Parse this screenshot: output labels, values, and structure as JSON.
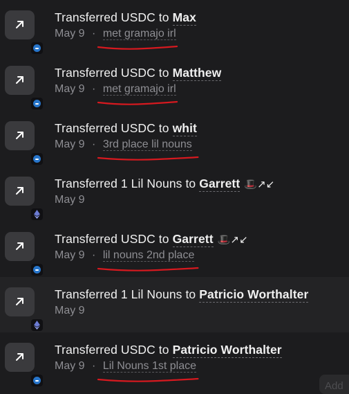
{
  "transactions": [
    {
      "action": "Transferred USDC to",
      "recipient": "Max",
      "recipient_extra": "",
      "date": "May 9",
      "note": "met gramajo irl",
      "asset_icon": "usdc-icon",
      "annotated": true,
      "highlight": false
    },
    {
      "action": "Transferred USDC to",
      "recipient": "Matthew",
      "recipient_extra": "",
      "date": "May 9",
      "note": "met gramajo irl",
      "asset_icon": "usdc-icon",
      "annotated": true,
      "highlight": false
    },
    {
      "action": "Transferred USDC to",
      "recipient": "whit",
      "recipient_extra": "",
      "date": "May 9",
      "note": "3rd place lil nouns",
      "asset_icon": "usdc-icon",
      "annotated": true,
      "highlight": false
    },
    {
      "action": "Transferred 1 Lil Nouns to",
      "recipient": "Garrett",
      "recipient_extra": "🎩↗↙",
      "date": "May 9",
      "note": "",
      "asset_icon": "ethereum-icon",
      "annotated": false,
      "highlight": false
    },
    {
      "action": "Transferred USDC to",
      "recipient": "Garrett",
      "recipient_extra": "🎩↗↙",
      "date": "May 9",
      "note": "lil nouns 2nd place",
      "asset_icon": "usdc-icon",
      "annotated": true,
      "highlight": false
    },
    {
      "action": "Transferred 1 Lil Nouns to",
      "recipient": "Patricio Worthalter",
      "recipient_extra": "",
      "date": "May 9",
      "note": "",
      "asset_icon": "ethereum-icon",
      "annotated": false,
      "highlight": true
    },
    {
      "action": "Transferred USDC to",
      "recipient": "Patricio Worthalter",
      "recipient_extra": "",
      "date": "May 9",
      "note": "Lil Nouns 1st place",
      "asset_icon": "usdc-icon",
      "annotated": true,
      "highlight": false
    }
  ],
  "meta_separator": "·",
  "add_button_label": "Add",
  "colors": {
    "background": "#1c1c1e",
    "tile": "#3a3a3d",
    "usdc": "#2775ca",
    "ethereum": "#6b7bd4",
    "annotation": "#d7191f"
  }
}
